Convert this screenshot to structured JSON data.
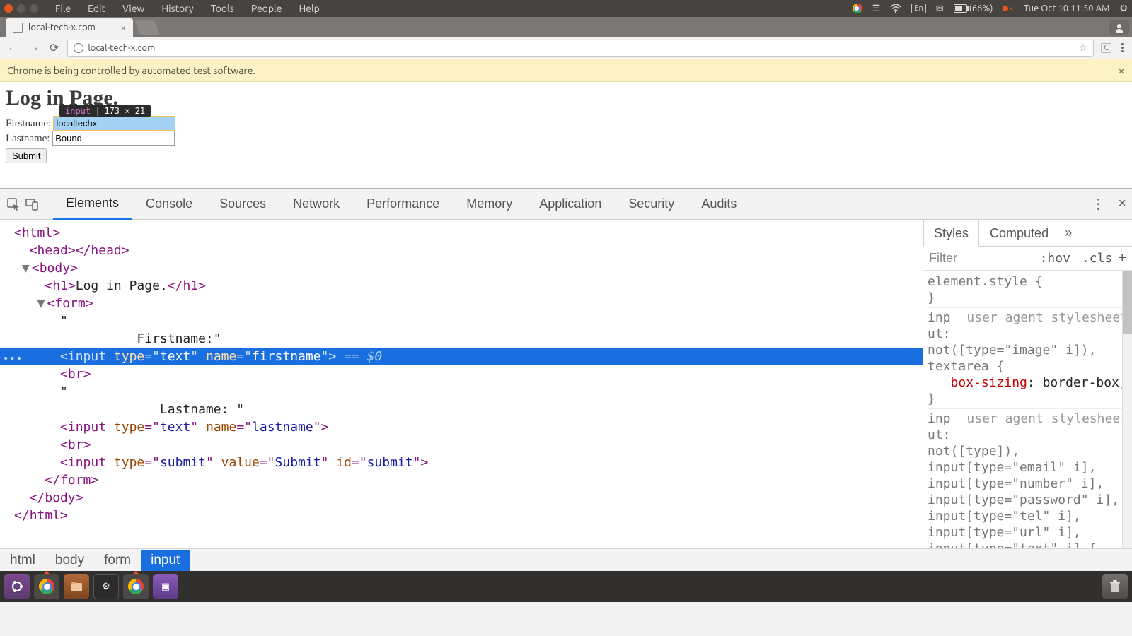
{
  "system_menu": {
    "items": [
      "File",
      "Edit",
      "View",
      "History",
      "Tools",
      "People",
      "Help"
    ],
    "battery": "(66%)",
    "lang": "En",
    "clock": "Tue Oct 10 11:50 AM"
  },
  "browser": {
    "tab_title": "local-tech-x.com",
    "url": "local-tech-x.com",
    "banner": "Chrome is being controlled by automated test software."
  },
  "page": {
    "heading": "Log in Page.",
    "firstname_label": "Firstname:",
    "lastname_label": "Lastname: ",
    "firstname_value": "localtechx",
    "lastname_value": "Bound",
    "submit_label": "Submit",
    "tooltip_tag": "input",
    "tooltip_size": "173 × 21"
  },
  "devtools": {
    "tabs": [
      "Elements",
      "Console",
      "Sources",
      "Network",
      "Performance",
      "Memory",
      "Application",
      "Security",
      "Audits"
    ],
    "active_tab": "Elements",
    "dom": {
      "l0": "<html>",
      "l1": "<head></head>",
      "l2": "<body>",
      "l3": "<h1>Log in Page.</h1>",
      "l4": "<form>",
      "l5a": "\"",
      "l5b": "Firstname:\"",
      "sel_pre": "<",
      "sel_tag": "input",
      "sel_a1n": " type",
      "sel_a1v": "text",
      "sel_a2n": " name",
      "sel_a2v": "firstname",
      "sel_suffix": " == $0",
      "l7": "<br>",
      "l8a": "\"",
      "l8b": "Lastname: \"",
      "l9": "<input type=\"text\" name=\"lastname\">",
      "l10": "<br>",
      "l11": "<input type=\"submit\" value=\"Submit\" id=\"submit\">",
      "l12": "</form>",
      "l13": "</body>",
      "l14": "</html>"
    },
    "breadcrumb": [
      "html",
      "body",
      "form",
      "input"
    ],
    "styles": {
      "tabs": [
        "Styles",
        "Computed"
      ],
      "filter": "Filter",
      "hov": ":hov",
      "cls": ".cls",
      "r1a": "element.style {",
      "r1b": "}",
      "uas": "user agent stylesheet",
      "r2a": "inp",
      "r2b": "ut:",
      "r2c": "not([type=\"image\" i]),",
      "r2d": "textarea {",
      "r2prop": "box-sizing",
      "r2val": ": border-box;",
      "r2e": "}",
      "r3a": "inp",
      "r3b": "ut:",
      "r3c": "not([type]),",
      "r3d": "input[type=\"email\" i],",
      "r3e": "input[type=\"number\" i],",
      "r3f": "input[type=\"password\" i],",
      "r3g": "input[type=\"tel\" i],",
      "r3h": "input[type=\"url\" i],",
      "r3i": "input[type=\"text\" i] {"
    }
  }
}
